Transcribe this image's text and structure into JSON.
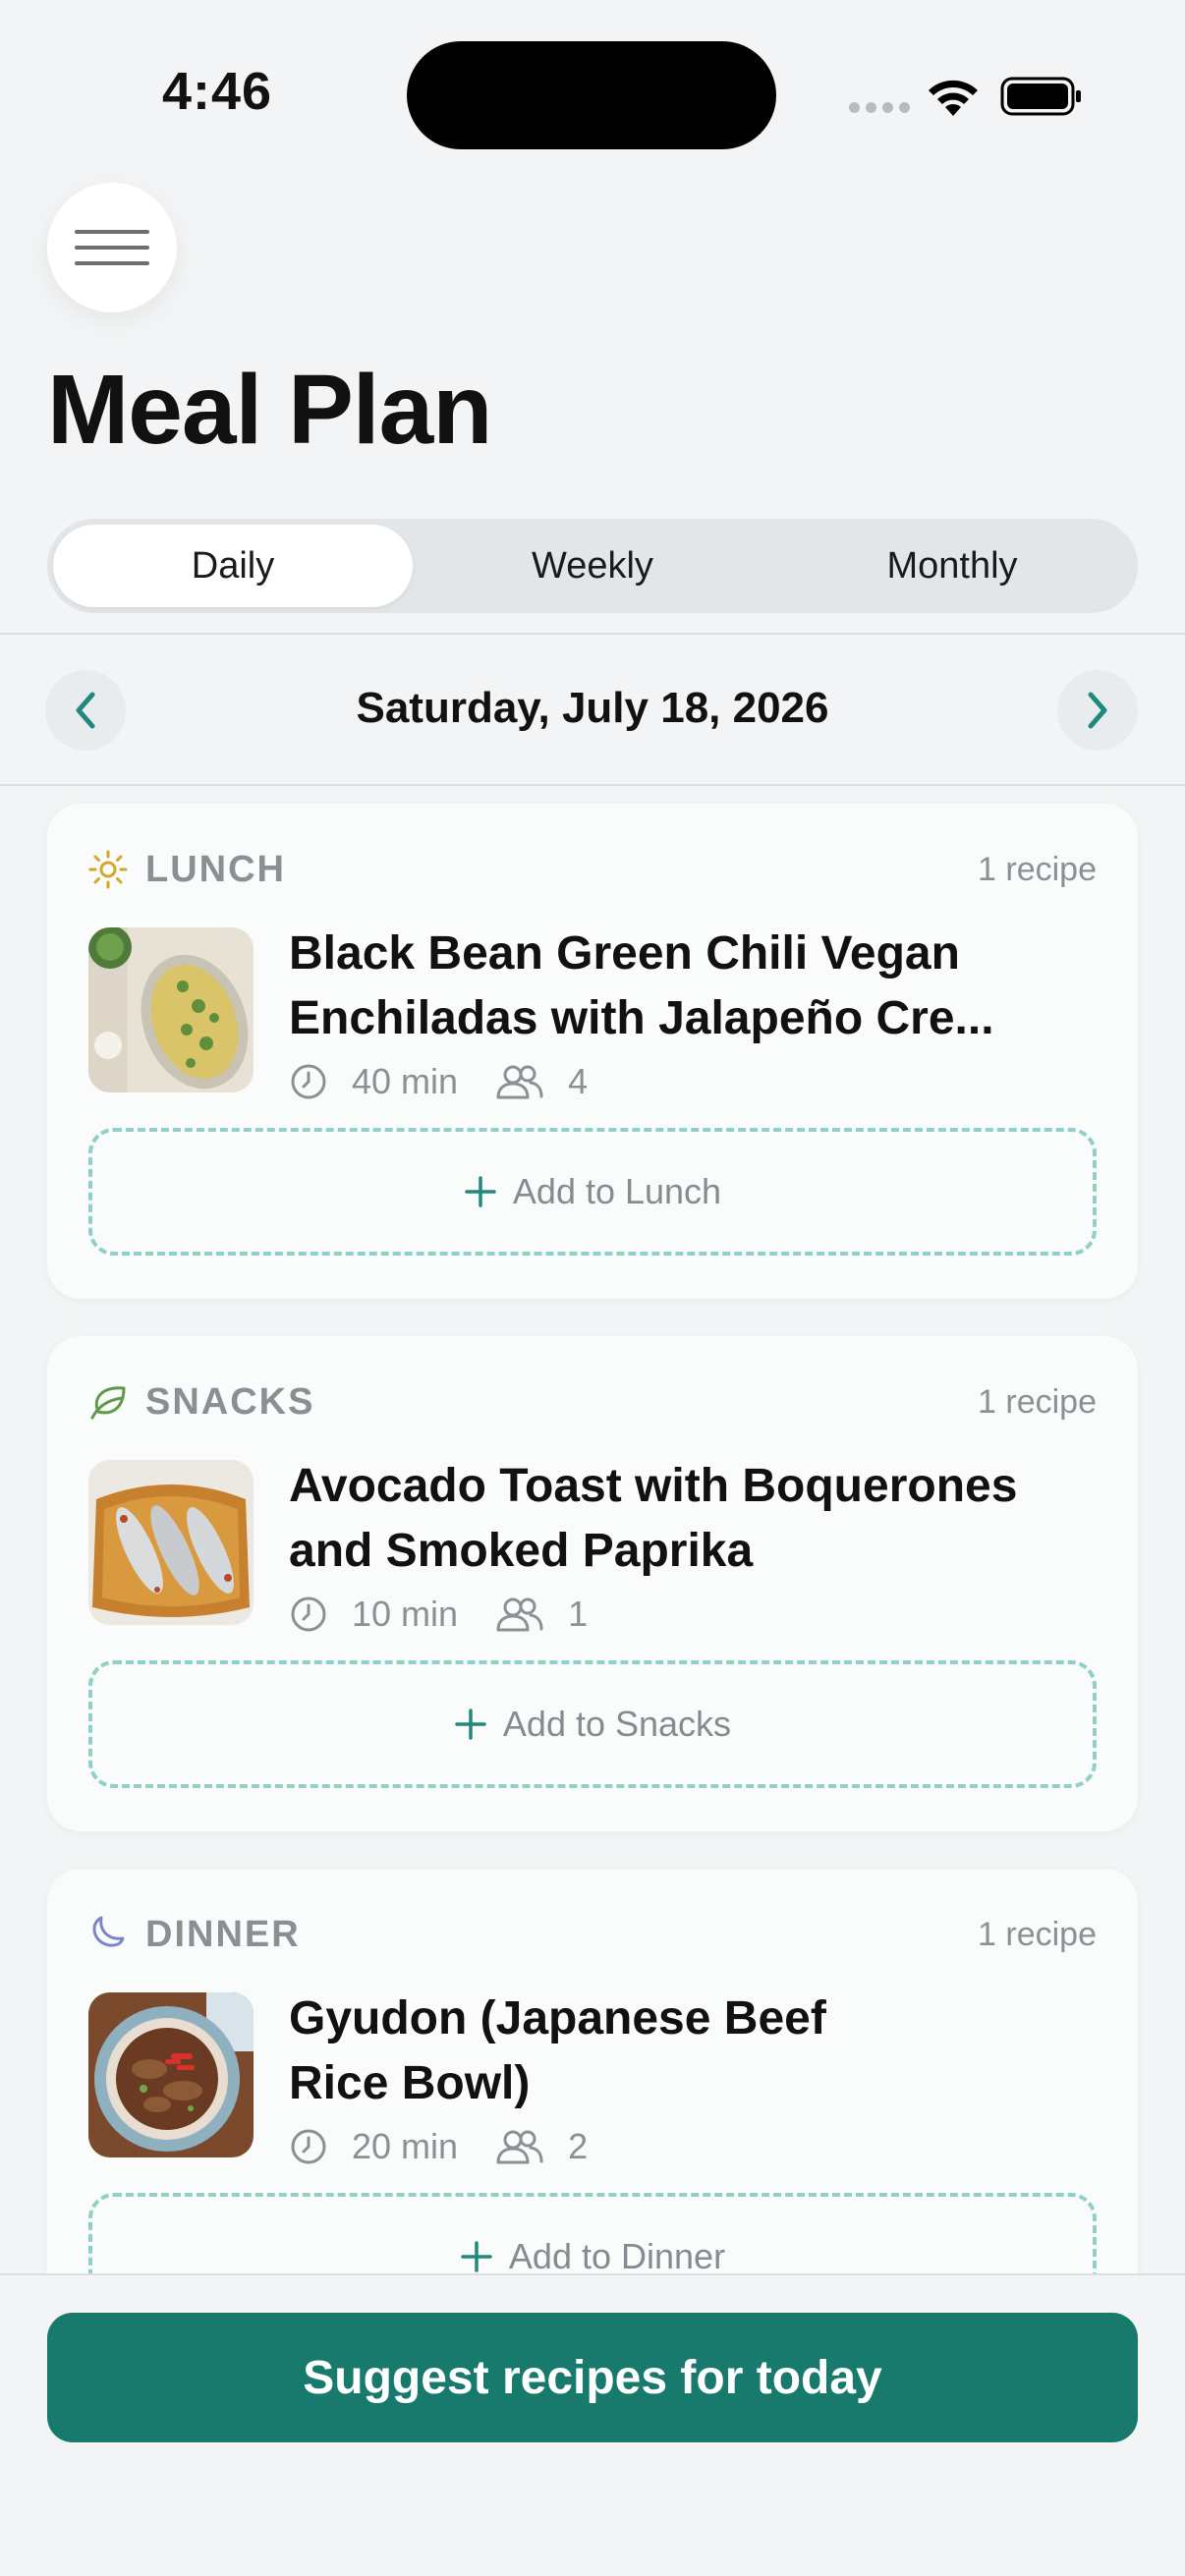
{
  "status_bar": {
    "time": "4:46"
  },
  "header": {
    "title": "Meal Plan"
  },
  "tabs": [
    {
      "label": "Daily",
      "active": true
    },
    {
      "label": "Weekly",
      "active": false
    },
    {
      "label": "Monthly",
      "active": false
    }
  ],
  "date_nav": {
    "date": "Saturday, July 18, 2026"
  },
  "meals": [
    {
      "name": "LUNCH",
      "icon": "sun-icon",
      "count": "1 recipe",
      "recipe": {
        "title": "Black Bean Green Chili Vegan Enchiladas with Jalapeño Cre...",
        "time": "40 min",
        "servings": "4"
      },
      "add_label": "Add to Lunch"
    },
    {
      "name": "SNACKS",
      "icon": "leaf-icon",
      "count": "1 recipe",
      "recipe": {
        "title": "Avocado Toast with Boquerones and Smoked Paprika",
        "time": "10 min",
        "servings": "1"
      },
      "add_label": "Add to Snacks"
    },
    {
      "name": "DINNER",
      "icon": "moon-icon",
      "count": "1 recipe",
      "recipe": {
        "title": "Gyudon (Japanese Beef Rice Bowl)",
        "time": "20 min",
        "servings": "2"
      },
      "add_label": "Add to Dinner"
    }
  ],
  "footer": {
    "suggest_label": "Suggest recipes for today"
  },
  "colors": {
    "accent": "#177a6d",
    "dashed_border": "#8fd0c8",
    "background": "#f2f4f5"
  }
}
